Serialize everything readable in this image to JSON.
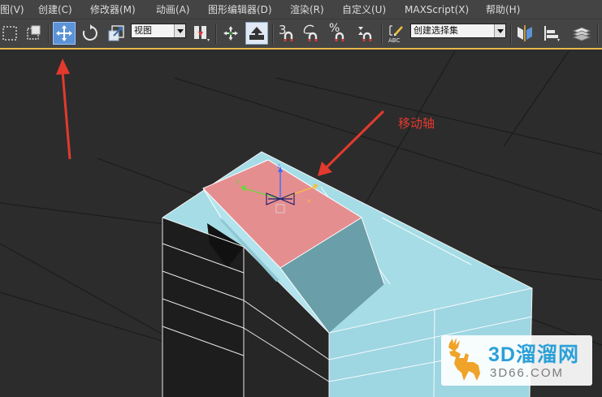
{
  "menu": {
    "items": [
      {
        "label": "图(V)"
      },
      {
        "label": "创建(C)"
      },
      {
        "label": "修改器(M)"
      },
      {
        "label": "动画(A)"
      },
      {
        "label": "图形编辑器(D)"
      },
      {
        "label": "渲染(R)"
      },
      {
        "label": "自定义(U)"
      },
      {
        "label": "MAXScript(X)"
      },
      {
        "label": "帮助(H)"
      }
    ]
  },
  "toolbar": {
    "reference_coord": "视图",
    "snap_angle": "3",
    "snap_percent": "%",
    "named_selection": "创建选择集",
    "edit_named_label": "ABC",
    "active_tool": "select-and-move"
  },
  "viewport": {
    "annotation_label": "移动轴",
    "axis_labels": {
      "x": "x",
      "y": "y",
      "z": "z"
    }
  },
  "colors": {
    "ui_background": "#444444",
    "active_tool": "#5b93d6",
    "toolbar_accent": "#e8b84a",
    "object_face": "#a6dce6",
    "selected_face": "#e58e90",
    "annotation": "#e23a2e",
    "watermark_blue": "#2aa0d8",
    "watermark_orange": "#f0a329"
  },
  "watermark": {
    "title": "3D溜溜网",
    "subtitle": "3D66.COM"
  }
}
